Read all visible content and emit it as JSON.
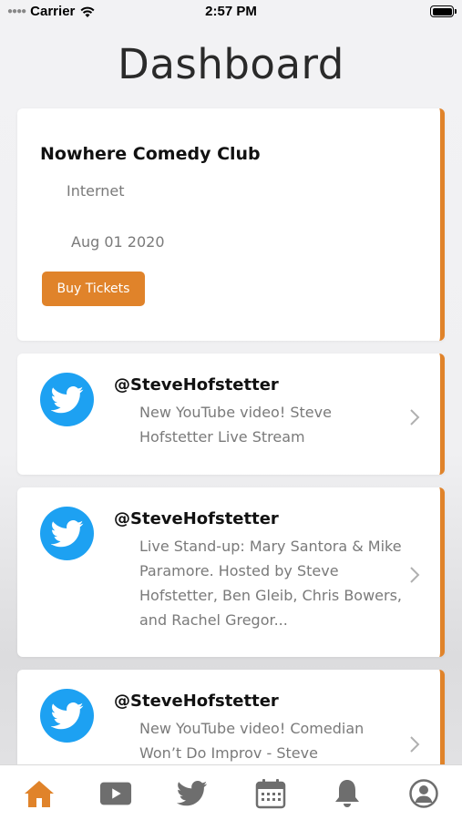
{
  "status_bar": {
    "carrier": "Carrier",
    "time": "2:57 PM"
  },
  "page": {
    "title": "Dashboard"
  },
  "event": {
    "title": "Nowhere Comedy Club",
    "location": "Internet",
    "date": "Aug 01 2020",
    "button_label": "Buy Tickets"
  },
  "tweets": [
    {
      "handle": "@SteveHofstetter",
      "text": "New YouTube video! Steve Hofstetter Live Stream"
    },
    {
      "handle": "@SteveHofstetter",
      "text": "Live Stand-up: Mary Santora & Mike Paramore. Hosted by Steve Hofstetter, Ben Gleib, Chris Bowers, and Rachel Gregor..."
    },
    {
      "handle": "@SteveHofstetter",
      "text": "New YouTube video! Comedian Won’t Do Improv - Steve"
    }
  ],
  "tab_bar": {
    "items": [
      {
        "icon": "home-icon",
        "active": true
      },
      {
        "icon": "youtube-icon",
        "active": false
      },
      {
        "icon": "twitter-icon",
        "active": false
      },
      {
        "icon": "calendar-icon",
        "active": false
      },
      {
        "icon": "bell-icon",
        "active": false
      },
      {
        "icon": "user-icon",
        "active": false
      }
    ]
  },
  "colors": {
    "accent": "#e0832a",
    "twitter": "#1da1f2",
    "inactive_icon": "#6e6e6e"
  }
}
